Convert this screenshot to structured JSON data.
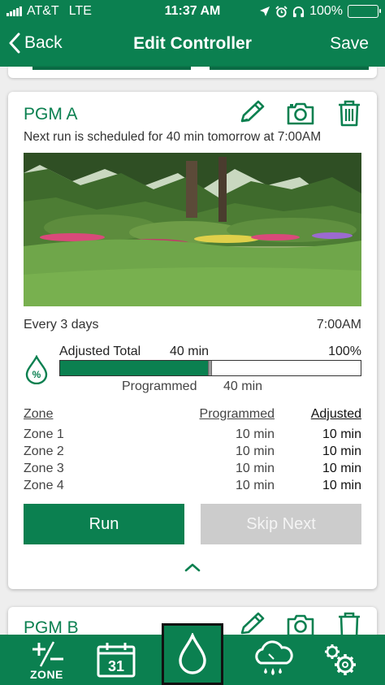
{
  "status_bar": {
    "carrier": "AT&T",
    "network": "LTE",
    "time": "11:37 AM",
    "battery": "100%"
  },
  "nav": {
    "back_label": "Back",
    "title": "Edit Controller",
    "save_label": "Save"
  },
  "program": {
    "name": "PGM A",
    "next_run": "Next run is scheduled for 40 min tomorrow at 7:00AM",
    "frequency": "Every 3 days",
    "start_time": "7:00AM",
    "adjusted_label": "Adjusted Total",
    "adjusted_total": "40 min",
    "adjusted_percent": "100%",
    "adjusted_fraction": 1.0,
    "programmed_label": "Programmed",
    "programmed_total": "40 min",
    "zone_headers": {
      "zone": "Zone",
      "programmed": "Programmed",
      "adjusted": "Adjusted"
    },
    "zones": [
      {
        "name": "Zone 1",
        "programmed": "10 min",
        "adjusted": "10 min"
      },
      {
        "name": "Zone 2",
        "programmed": "10 min",
        "adjusted": "10 min"
      },
      {
        "name": "Zone 3",
        "programmed": "10 min",
        "adjusted": "10 min"
      },
      {
        "name": "Zone 4",
        "programmed": "10 min",
        "adjusted": "10 min"
      }
    ],
    "run_label": "Run",
    "skip_label": "Skip Next",
    "icons": [
      "pencil-icon",
      "camera-icon",
      "trash-icon",
      "percent-drop-icon",
      "chevron-up-icon"
    ]
  },
  "next_program": {
    "name": "PGM B"
  },
  "tab_bar": {
    "zone_label": "ZONE",
    "calendar_day": "31",
    "icons": [
      "plus-minus-icon",
      "calendar-icon",
      "water-drop-icon",
      "cloud-rain-icon",
      "gears-icon"
    ]
  },
  "colors": {
    "brand_green": "#0b8050",
    "disabled_gray": "#cccccc"
  }
}
